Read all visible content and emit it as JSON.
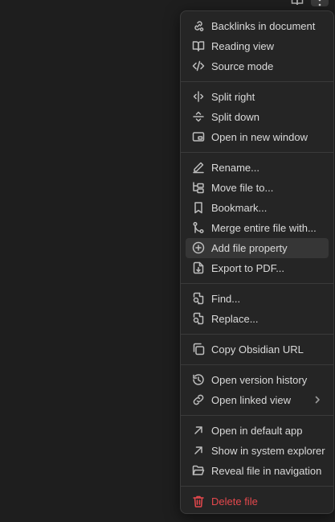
{
  "menu": {
    "groups": [
      [
        {
          "label": "Backlinks in document",
          "icon": "backlinks-icon"
        },
        {
          "label": "Reading view",
          "icon": "book-open-icon"
        },
        {
          "label": "Source mode",
          "icon": "code-icon"
        }
      ],
      [
        {
          "label": "Split right",
          "icon": "split-vertical-icon"
        },
        {
          "label": "Split down",
          "icon": "split-horizontal-icon"
        },
        {
          "label": "Open in new window",
          "icon": "new-window-icon"
        }
      ],
      [
        {
          "label": "Rename...",
          "icon": "pencil-icon"
        },
        {
          "label": "Move file to...",
          "icon": "move-folder-icon"
        },
        {
          "label": "Bookmark...",
          "icon": "bookmark-icon"
        },
        {
          "label": "Merge entire file with...",
          "icon": "git-merge-icon"
        },
        {
          "label": "Add file property",
          "icon": "plus-circle-icon"
        },
        {
          "label": "Export to PDF...",
          "icon": "file-export-icon"
        }
      ],
      [
        {
          "label": "Find...",
          "icon": "file-search-icon"
        },
        {
          "label": "Replace...",
          "icon": "file-replace-icon"
        }
      ],
      [
        {
          "label": "Copy Obsidian URL",
          "icon": "copy-icon"
        }
      ],
      [
        {
          "label": "Open version history",
          "icon": "history-icon"
        },
        {
          "label": "Open linked view",
          "icon": "link-icon"
        }
      ],
      [
        {
          "label": "Open in default app",
          "icon": "arrow-up-right-icon"
        },
        {
          "label": "Show in system explorer",
          "icon": "arrow-up-right-icon"
        },
        {
          "label": "Reveal file in navigation",
          "icon": "folder-open-icon"
        }
      ],
      [
        {
          "label": "Delete file",
          "icon": "trash-icon"
        }
      ]
    ],
    "hovered_item": "Add file property",
    "submenu_item": "Open linked view",
    "danger_item": "Delete file"
  },
  "top_bar": {
    "icons": [
      "book-open-icon",
      "more-options-icon"
    ]
  },
  "colors": {
    "background": "#1e1e1e",
    "menu_background": "#252525",
    "text": "#dadada",
    "hover": "#363636",
    "danger": "#e5484d"
  }
}
